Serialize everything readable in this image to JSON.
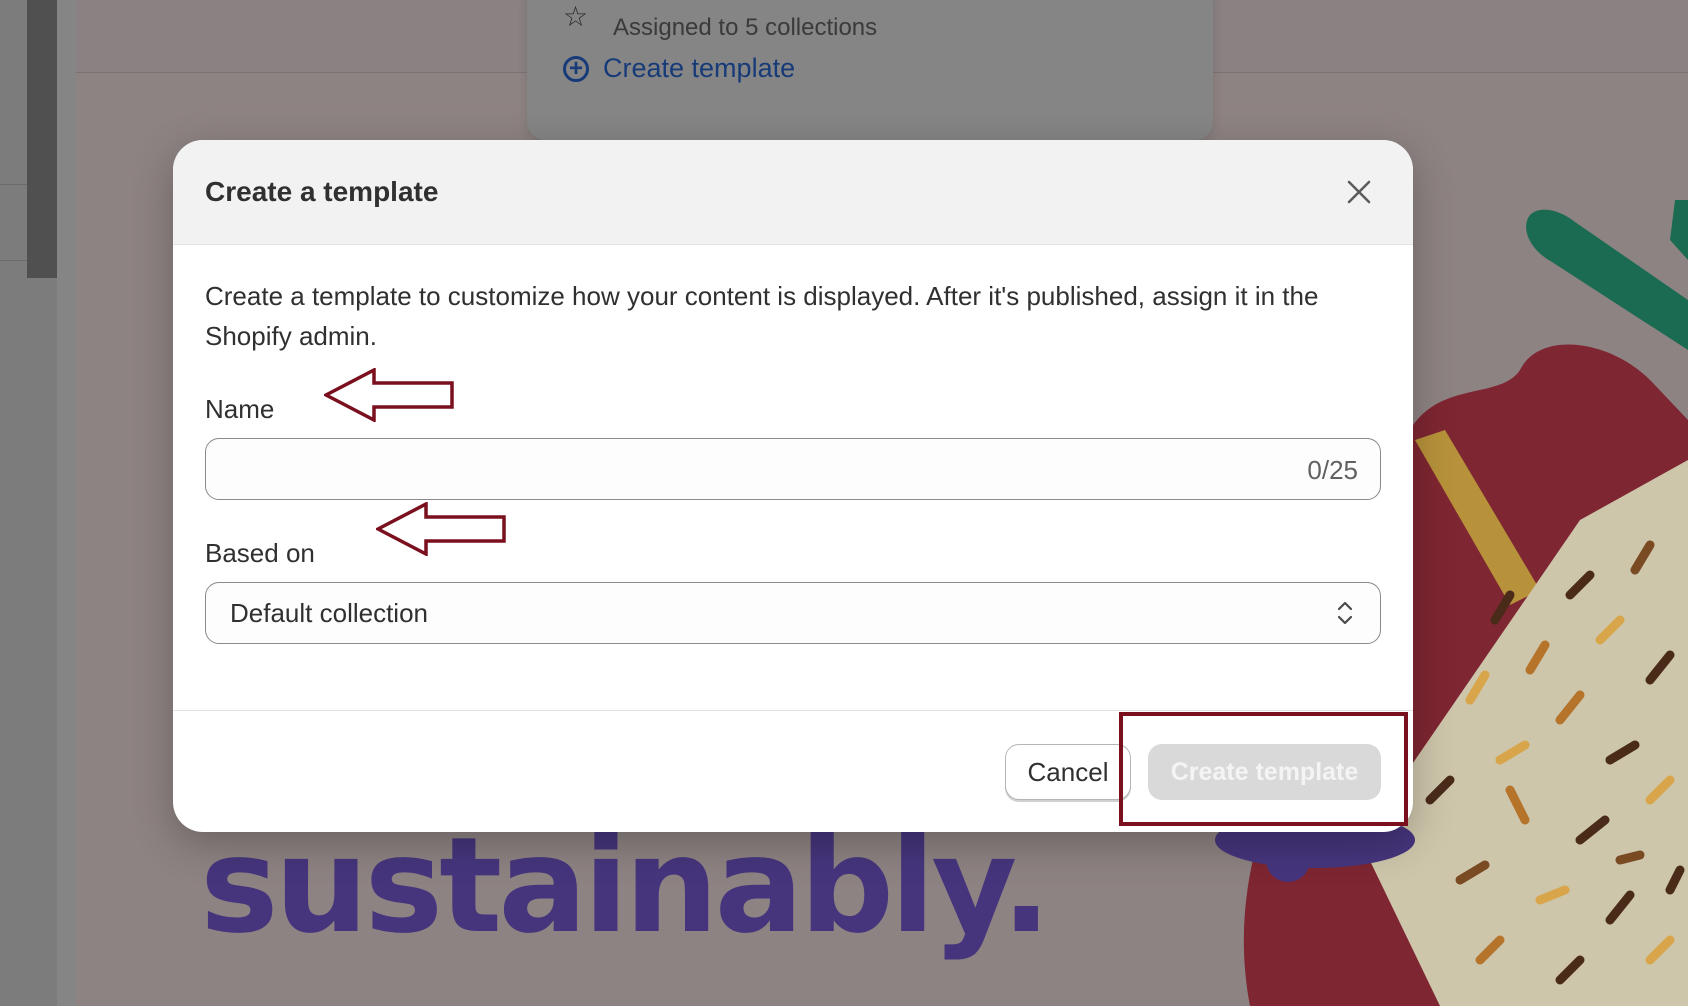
{
  "background": {
    "dropdown": {
      "assigned_text": "Assigned to 5 collections",
      "create_link": "Create template"
    },
    "hero_text": "sustainably."
  },
  "modal": {
    "title": "Create a template",
    "description": "Create a template to customize how your content is displayed. After it's published, assign it in the Shopify admin.",
    "name_field": {
      "label": "Name",
      "value": "",
      "counter": "0/25"
    },
    "based_on_field": {
      "label": "Based on",
      "selected": "Default collection"
    },
    "buttons": {
      "cancel": "Cancel",
      "create": "Create template"
    }
  },
  "colors": {
    "annotation": "#7a0f1e",
    "link": "#173a78",
    "hero": "#46357d"
  }
}
